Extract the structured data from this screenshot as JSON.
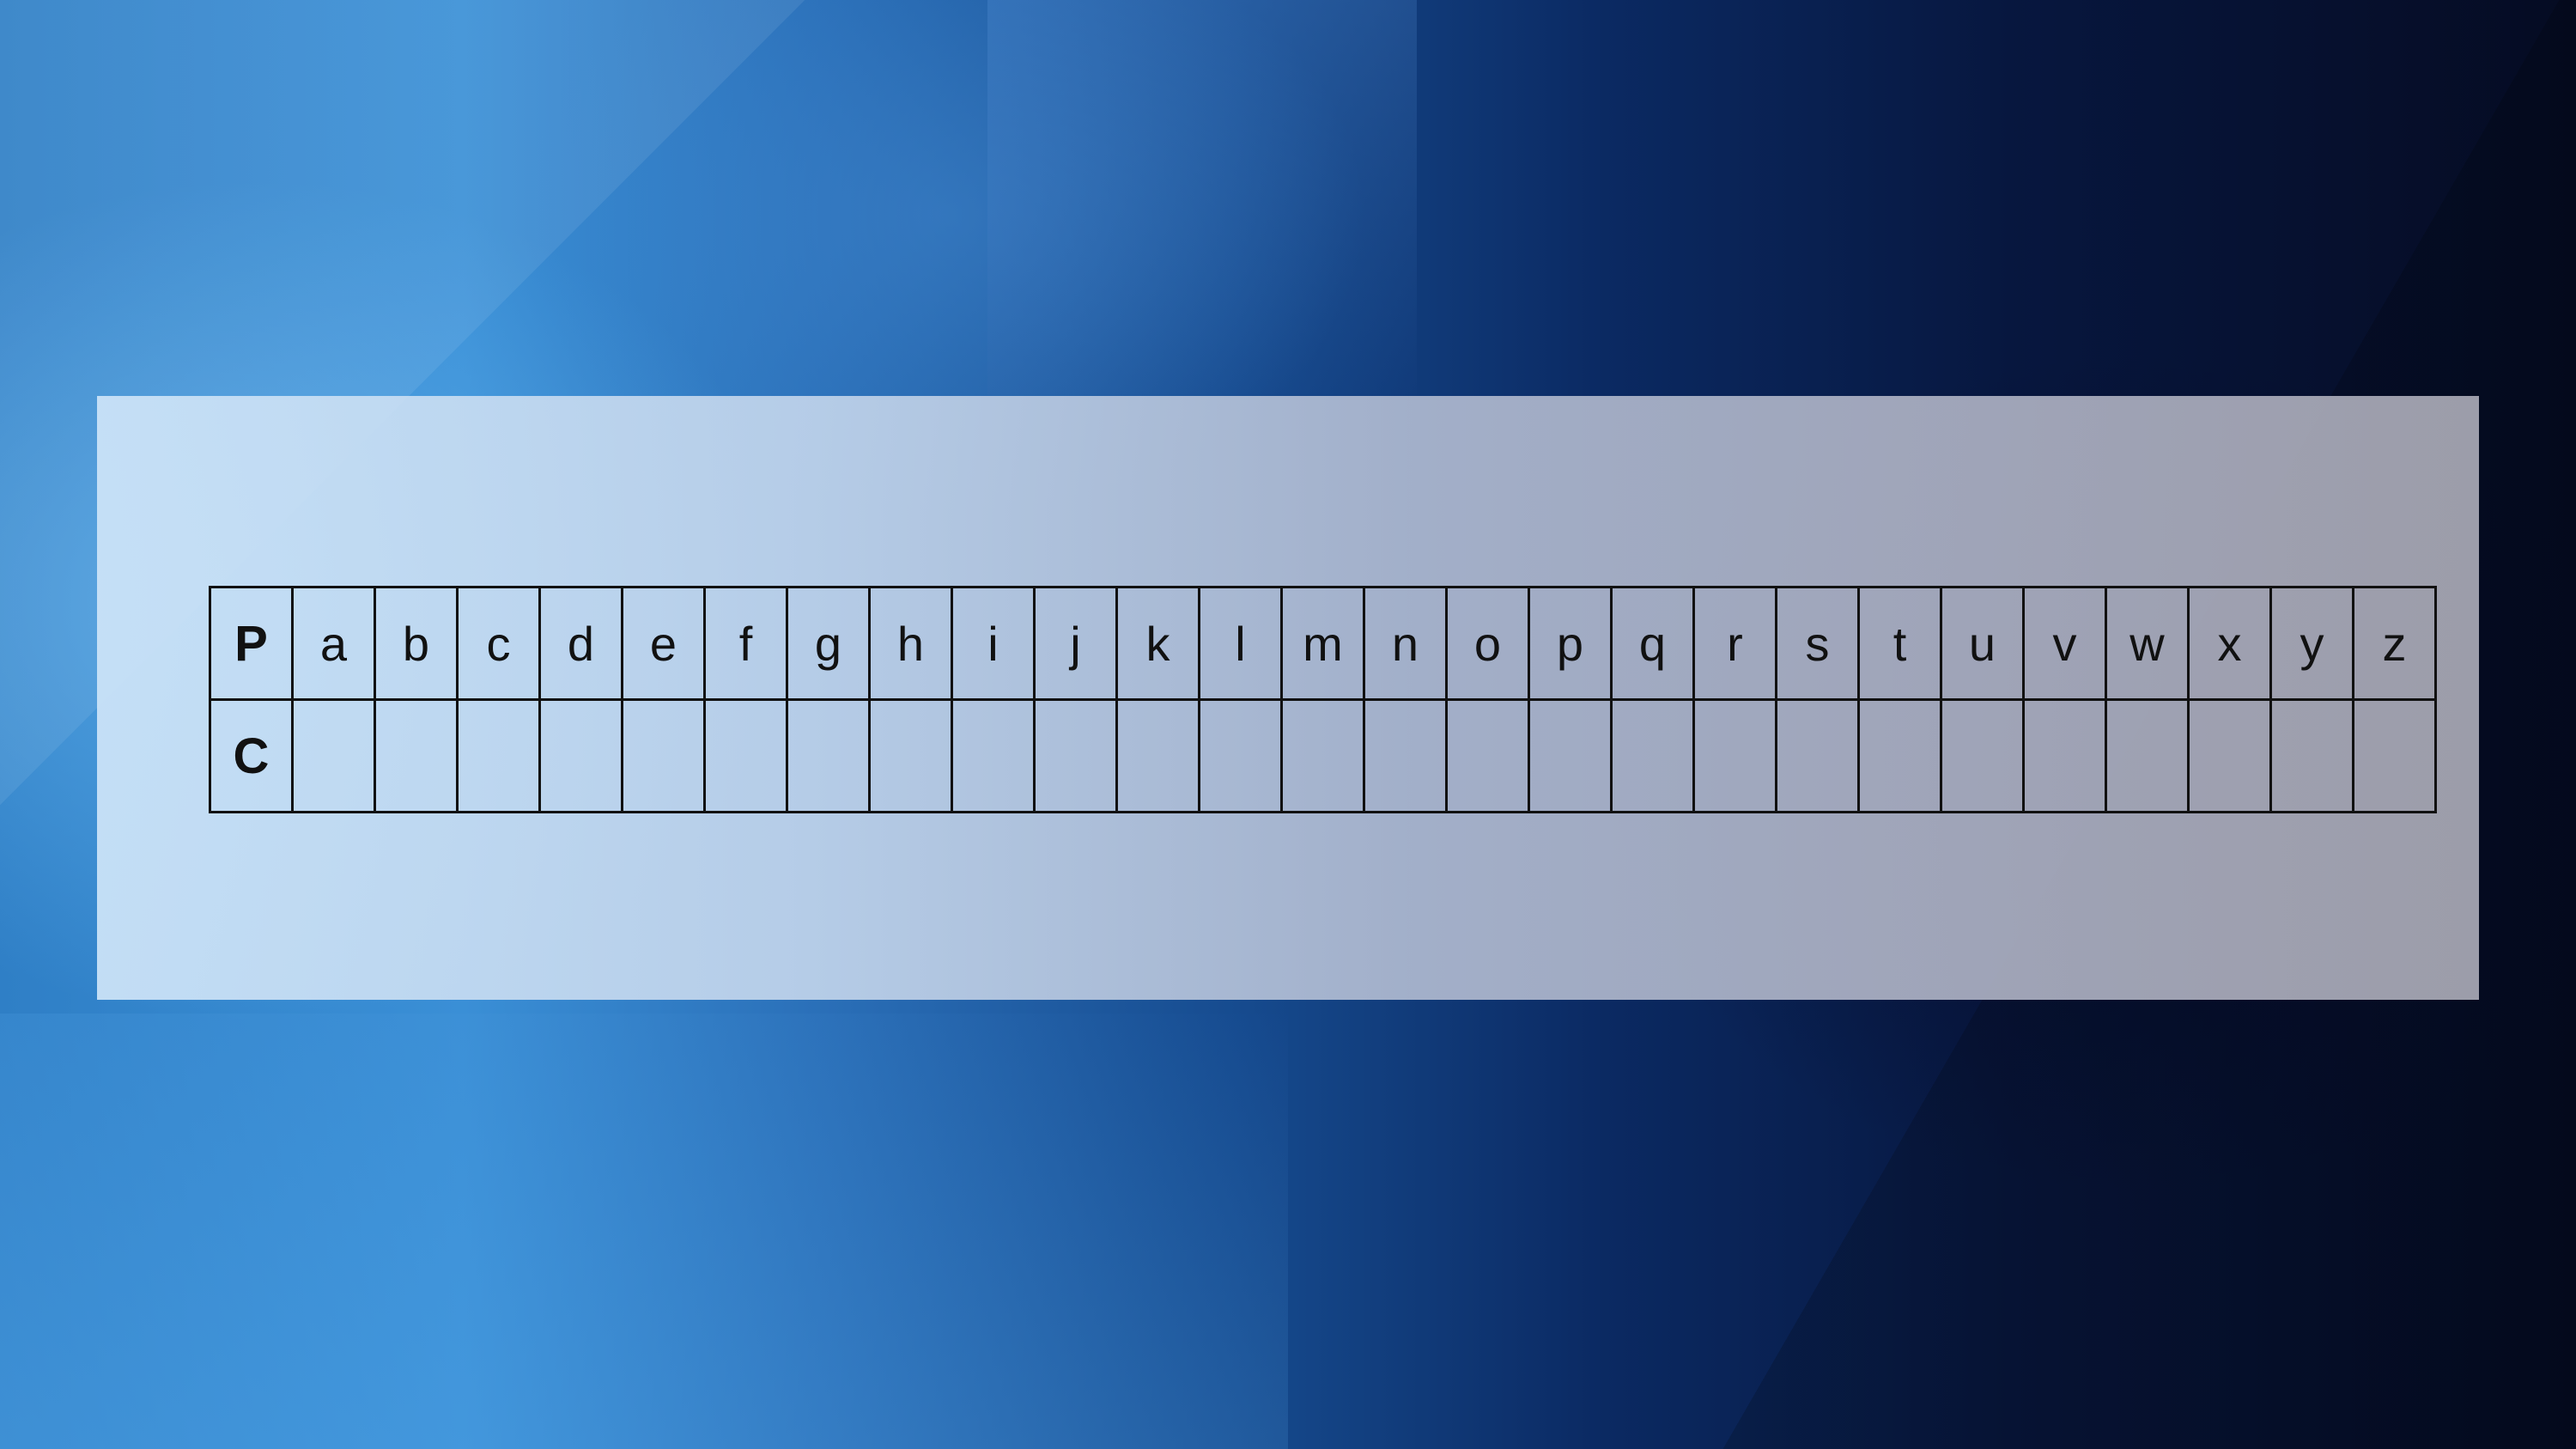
{
  "background": {
    "theme": "blue abstract faceted gradient",
    "colors": [
      "#3a8fd6",
      "#164b8f",
      "#050b22"
    ]
  },
  "cipher_table": {
    "plain_label": "P",
    "cipher_label": "C",
    "plain_letters": [
      "a",
      "b",
      "c",
      "d",
      "e",
      "f",
      "g",
      "h",
      "i",
      "j",
      "k",
      "l",
      "m",
      "n",
      "o",
      "p",
      "q",
      "r",
      "s",
      "t",
      "u",
      "v",
      "w",
      "x",
      "y",
      "z"
    ],
    "cipher_letters": [
      "",
      "",
      "",
      "",
      "",
      "",
      "",
      "",
      "",
      "",
      "",
      "",
      "",
      "",
      "",
      "",
      "",
      "",
      "",
      "",
      "",
      "",
      "",
      "",
      "",
      ""
    ]
  }
}
